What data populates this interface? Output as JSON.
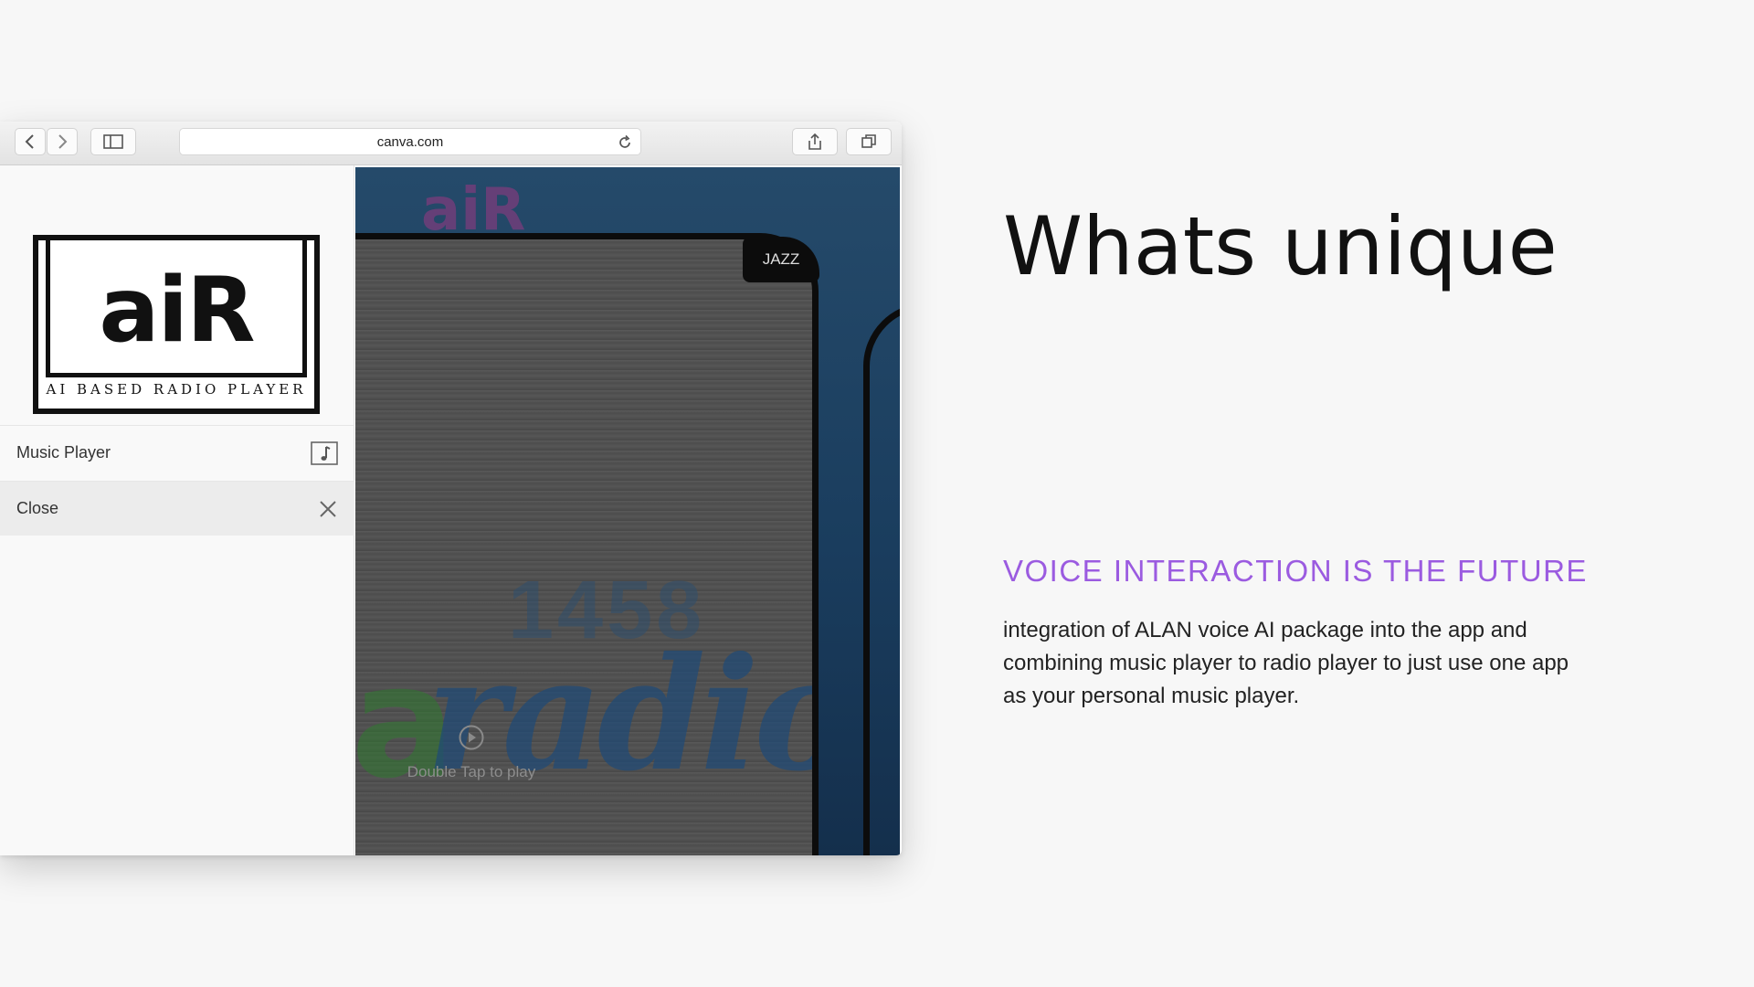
{
  "browser": {
    "address": "canva.com"
  },
  "sidebar": {
    "logo": {
      "text": "aiR",
      "subtitle": "AI BASED RADIO PLAYER"
    },
    "items": [
      {
        "label": "Music Player",
        "icon": "music-note-icon"
      },
      {
        "label": "Close",
        "icon": "close-icon"
      }
    ]
  },
  "player": {
    "station_tag": "JAZZ",
    "play_hint": "Double Tap to play",
    "background_text": "aiR",
    "station_number": "1458",
    "station_brand": "radio"
  },
  "content": {
    "title": "Whats unique",
    "subtitle": "VOICE INTERACTION IS THE FUTURE",
    "body": "integration of ALAN voice AI package into the app and combining music player to radio player to just use one app as your personal music player."
  },
  "colors": {
    "accent": "#9b5be0",
    "player_bg": "#1a3d5e",
    "page_bg": "#f7f7f7"
  }
}
